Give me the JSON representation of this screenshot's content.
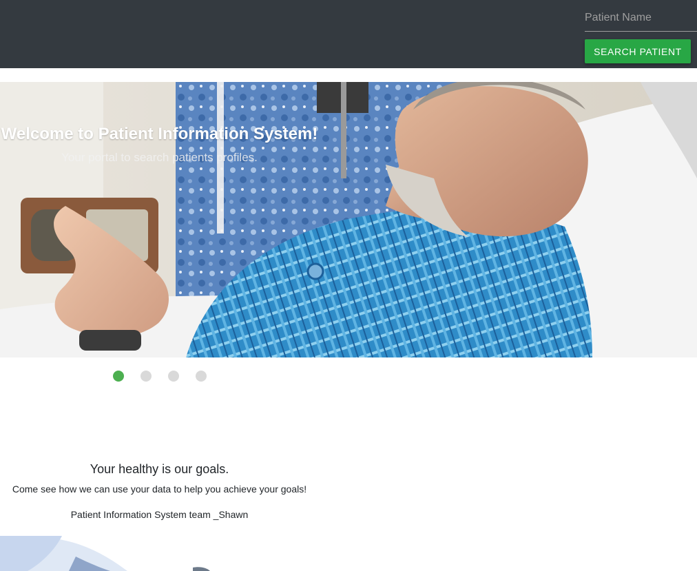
{
  "navbar": {
    "search_placeholder": "Patient Name",
    "search_button_label": "SEARCH PATIENT"
  },
  "carousel": {
    "slide_title": "Welcome to Patient Information System!",
    "slide_subtitle": "Your portal to search patients profiles.",
    "indicator_count": 4,
    "active_index": 0,
    "indicator_labels": [
      "slide 1",
      "slide 2",
      "slide 3",
      "slide 4"
    ]
  },
  "about": {
    "title": "Your healthy is our goals.",
    "text": "Come see how we can use your data to help you achieve your goals!",
    "signature": "Patient Information System team _Shawn"
  },
  "colors": {
    "navbar_bg": "#343a40",
    "accent_green": "#28a745",
    "indicator_active": "#4caf50",
    "indicator_inactive": "#d9d9d9"
  }
}
